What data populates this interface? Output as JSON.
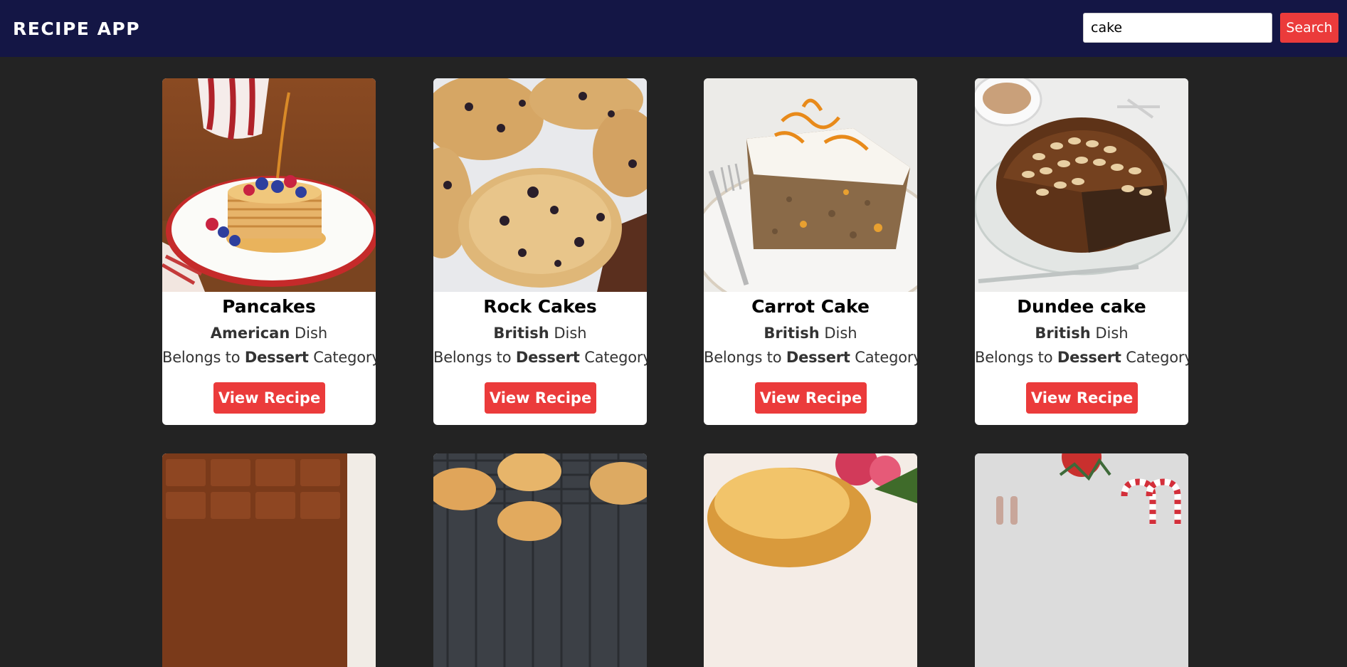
{
  "app": {
    "title": "RECIPE APP"
  },
  "search": {
    "value": "cake",
    "button_label": "Search"
  },
  "cards": [
    {
      "title": "Pancakes",
      "area": "American",
      "area_suffix": "Dish",
      "category_prefix": "Belongs to",
      "category": "Dessert",
      "category_suffix": "Category",
      "button_label": "View Recipe"
    },
    {
      "title": "Rock Cakes",
      "area": "British",
      "area_suffix": "Dish",
      "category_prefix": "Belongs to",
      "category": "Dessert",
      "category_suffix": "Category",
      "button_label": "View Recipe"
    },
    {
      "title": "Carrot Cake",
      "area": "British",
      "area_suffix": "Dish",
      "category_prefix": "Belongs to",
      "category": "Dessert",
      "category_suffix": "Category",
      "button_label": "View Recipe"
    },
    {
      "title": "Dundee cake",
      "area": "British",
      "area_suffix": "Dish",
      "category_prefix": "Belongs to",
      "category": "Dessert",
      "category_suffix": "Category",
      "button_label": "View Recipe"
    }
  ],
  "colors": {
    "header_bg": "#141645",
    "page_bg": "#232323",
    "accent": "#eb3b3b"
  }
}
